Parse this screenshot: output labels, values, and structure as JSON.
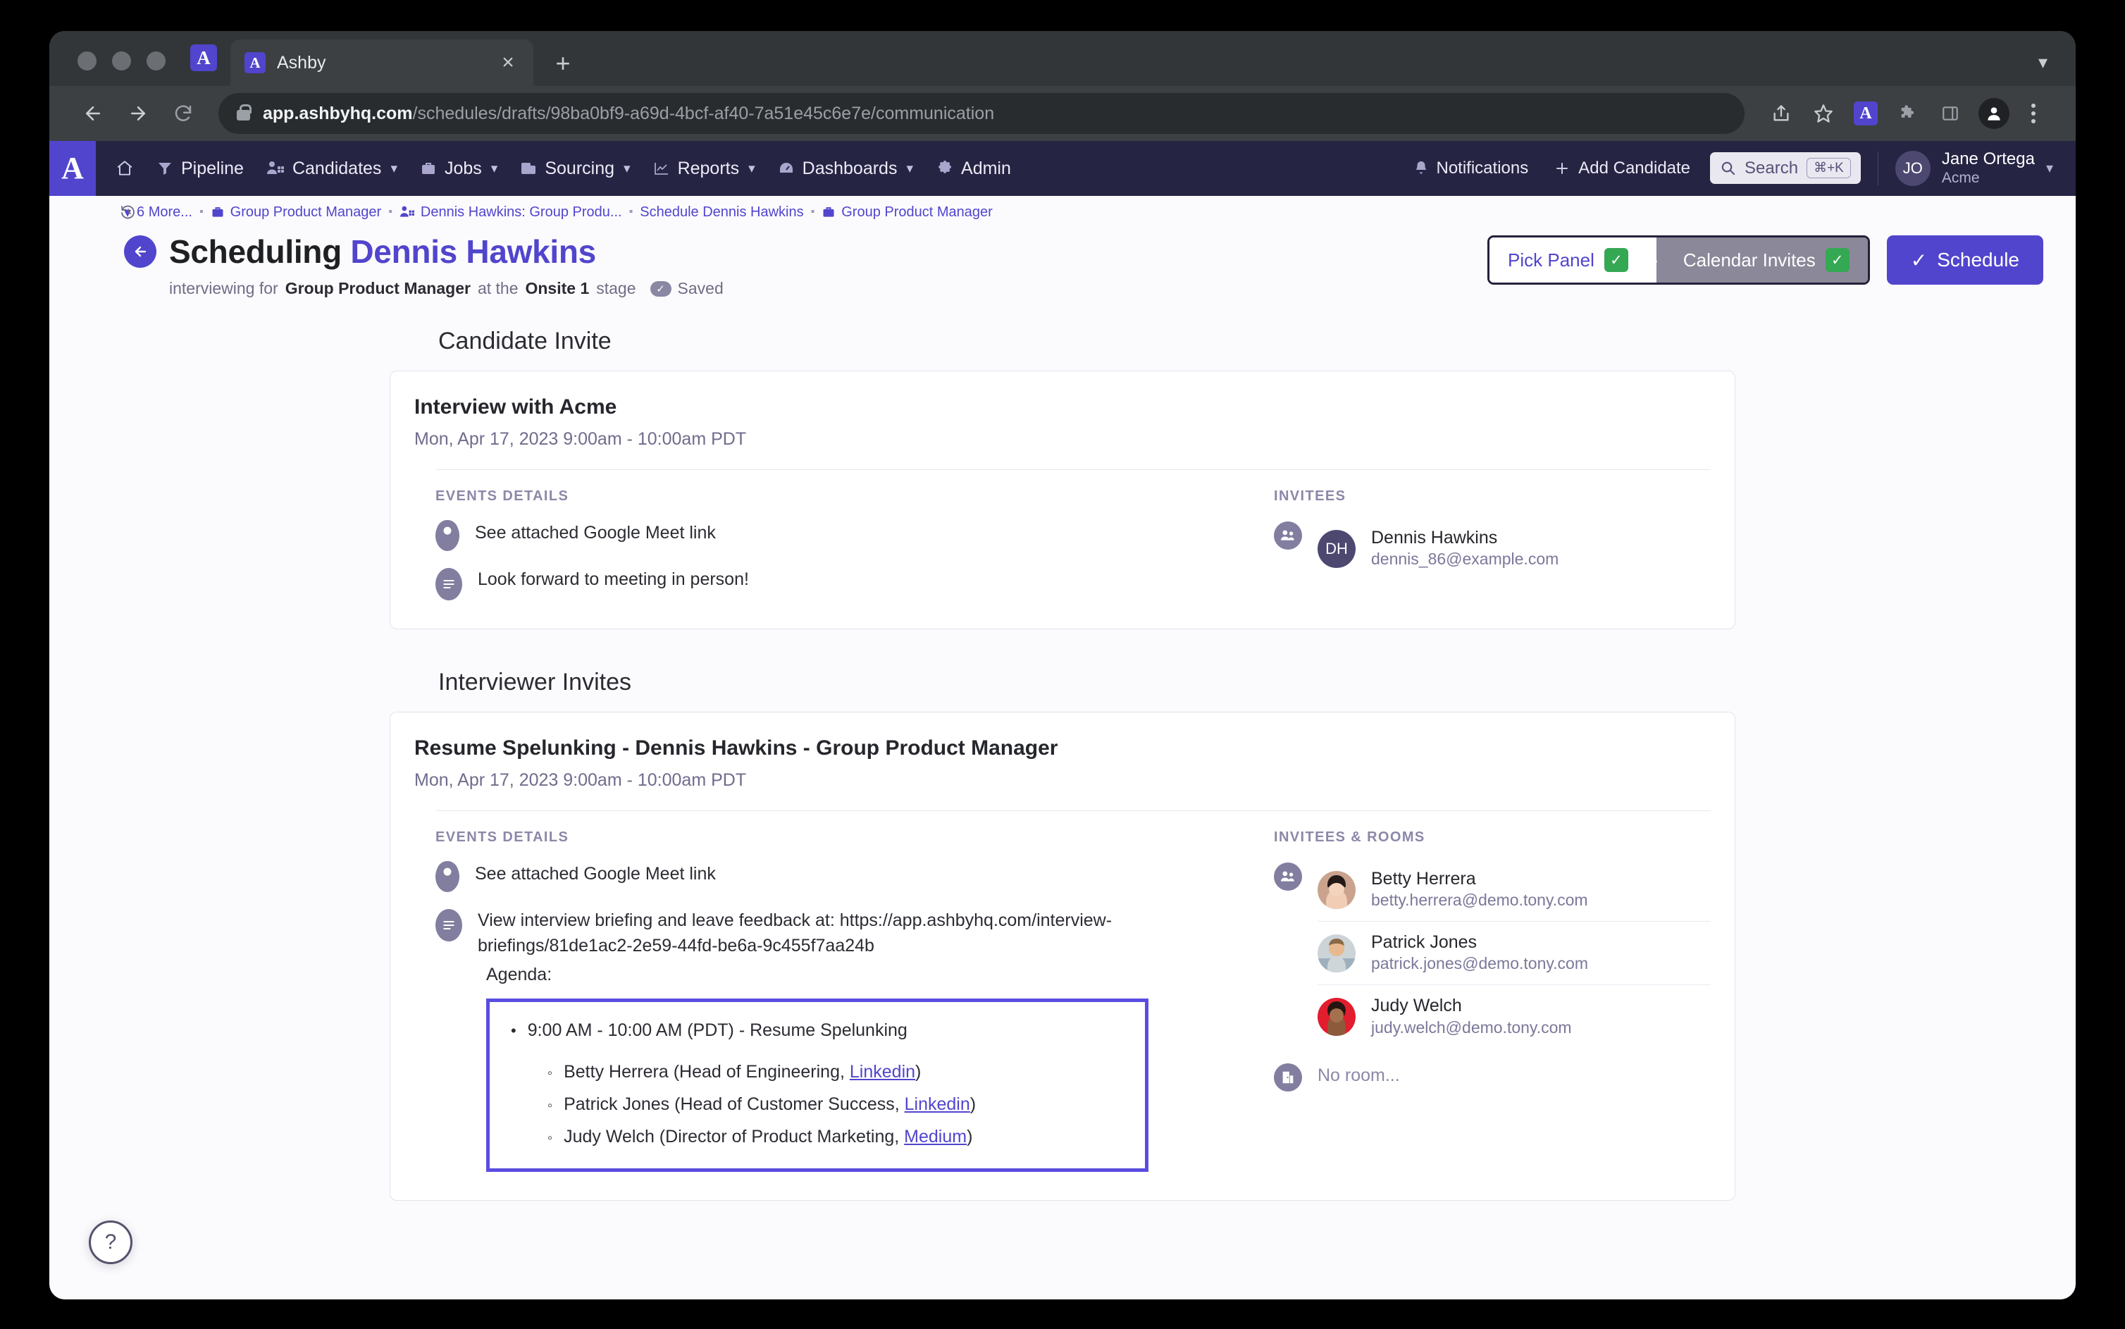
{
  "browser": {
    "tab_title": "Ashby",
    "url_host": "app.ashbyhq.com",
    "url_path": "/schedules/drafts/98ba0bf9-a69d-4bcf-af40-7a51e45c6e7e/communication",
    "new_tab_label": "+",
    "close_tab_label": "×"
  },
  "appnav": {
    "logo_letter": "A",
    "items": [
      {
        "label": "",
        "icon": "home-icon",
        "caret": false
      },
      {
        "label": "Pipeline",
        "icon": "funnel-icon",
        "caret": false
      },
      {
        "label": "Candidates",
        "icon": "people-icon",
        "caret": true
      },
      {
        "label": "Jobs",
        "icon": "briefcase-icon",
        "caret": true
      },
      {
        "label": "Sourcing",
        "icon": "sourcing-icon",
        "caret": true
      },
      {
        "label": "Reports",
        "icon": "chart-icon",
        "caret": true
      },
      {
        "label": "Dashboards",
        "icon": "gauge-icon",
        "caret": true
      },
      {
        "label": "Admin",
        "icon": "gear-icon",
        "caret": false
      }
    ],
    "notifications_label": "Notifications",
    "add_candidate_label": "Add Candidate",
    "search_label": "Search",
    "search_shortcut": "⌘+K",
    "user_initials": "JO",
    "user_name": "Jane Ortega",
    "user_org": "Acme"
  },
  "breadcrumbs": [
    {
      "label": "6 More...",
      "icon": "chevron-down-icon"
    },
    {
      "label": "Group Product Manager",
      "icon": "briefcase-icon"
    },
    {
      "label": "Dennis Hawkins: Group Produ...",
      "icon": "people-icon"
    },
    {
      "label": "Schedule Dennis Hawkins",
      "icon": ""
    },
    {
      "label": "Group Product Manager",
      "icon": "briefcase-icon"
    }
  ],
  "header": {
    "title_prefix": "Scheduling",
    "title_name": "Dennis Hawkins",
    "sub_prefix": "interviewing for",
    "sub_job": "Group Product Manager",
    "sub_mid": "at the",
    "sub_stage": "Onsite 1",
    "sub_suffix": "stage",
    "saved_label": "Saved",
    "steps": [
      {
        "label": "Pick Panel",
        "state": "done"
      },
      {
        "label": "Calendar Invites",
        "state": "current"
      }
    ],
    "schedule_label": "Schedule",
    "accent_color": "#5145cd",
    "success_color": "#34a853"
  },
  "candidate_section": {
    "heading": "Candidate Invite",
    "card": {
      "title": "Interview with Acme",
      "datetime": "Mon, Apr 17, 2023 9:00am - 10:00am PDT",
      "details_label": "Events Details",
      "location": "See attached Google Meet link",
      "description": "Look forward to meeting in person!",
      "invitees_label": "Invitees",
      "invitees": [
        {
          "initials": "DH",
          "name": "Dennis Hawkins",
          "email": "dennis_86@example.com"
        }
      ]
    }
  },
  "interviewer_section": {
    "heading": "Interviewer Invites",
    "card": {
      "title": "Resume Spelunking - Dennis Hawkins - Group Product Manager",
      "datetime": "Mon, Apr 17, 2023 9:00am - 10:00am PDT",
      "details_label": "Events Details",
      "location": "See attached Google Meet link",
      "briefing_text": "View interview briefing and leave feedback at: https://app.ashbyhq.com/interview-briefings/81de1ac2-2e59-44fd-be6a-9c455f7aa24b",
      "agenda_label": "Agenda:",
      "agenda": {
        "heading": "9:00 AM - 10:00 AM (PDT) - Resume Spelunking",
        "entries": [
          {
            "name": "Betty Herrera",
            "role": "Head of Engineering",
            "link": "Linkedin"
          },
          {
            "name": "Patrick Jones",
            "role": "Head of Customer Success",
            "link": "Linkedin"
          },
          {
            "name": "Judy Welch",
            "role": "Director of Product Marketing",
            "link": "Medium"
          }
        ]
      },
      "invitees_label": "Invitees & Rooms",
      "invitees": [
        {
          "name": "Betty Herrera",
          "email": "betty.herrera@demo.tony.com",
          "photo": "betty"
        },
        {
          "name": "Patrick Jones",
          "email": "patrick.jones@demo.tony.com",
          "photo": "patrick"
        },
        {
          "name": "Judy Welch",
          "email": "judy.welch@demo.tony.com",
          "photo": "judy"
        }
      ],
      "room_text": "No room..."
    }
  },
  "help": {
    "label": "?"
  }
}
